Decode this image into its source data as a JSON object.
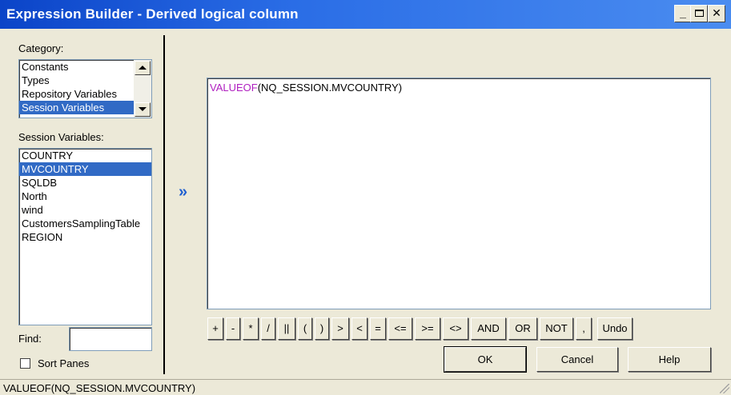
{
  "window": {
    "title": "Expression Builder - Derived logical column",
    "min_glyph": "_",
    "close_glyph": "✕"
  },
  "left": {
    "category_label": "Category:",
    "categories": [
      "Constants",
      "Types",
      "Repository Variables",
      "Session Variables"
    ],
    "selected_category": "Session Variables",
    "session_vars_label": "Session Variables:",
    "session_vars": [
      "COUNTRY",
      "MVCOUNTRY",
      "SQLDB",
      "North",
      "wind",
      "CustomersSamplingTable",
      "REGION"
    ],
    "selected_session_var": "MVCOUNTRY",
    "find_label": "Find:",
    "find_value": "",
    "sort_panes_label": "Sort Panes",
    "sort_panes_checked": false
  },
  "insert_glyph": "»",
  "expression": {
    "function": "VALUEOF",
    "argument": "(NQ_SESSION.MVCOUNTRY)"
  },
  "operators": [
    "+",
    "-",
    "*",
    "/",
    "||",
    "(",
    ")",
    ">",
    "<",
    "=",
    "<=",
    ">=",
    "<>",
    "AND",
    "OR",
    "NOT",
    ",",
    "Undo"
  ],
  "buttons": {
    "ok": "OK",
    "cancel": "Cancel",
    "help": "Help"
  },
  "status": "VALUEOF(NQ_SESSION.MVCOUNTRY)",
  "colors": {
    "selection": "#316ac5",
    "keyword": "#b020c0",
    "title_gradient_start": "#0b44c8"
  }
}
